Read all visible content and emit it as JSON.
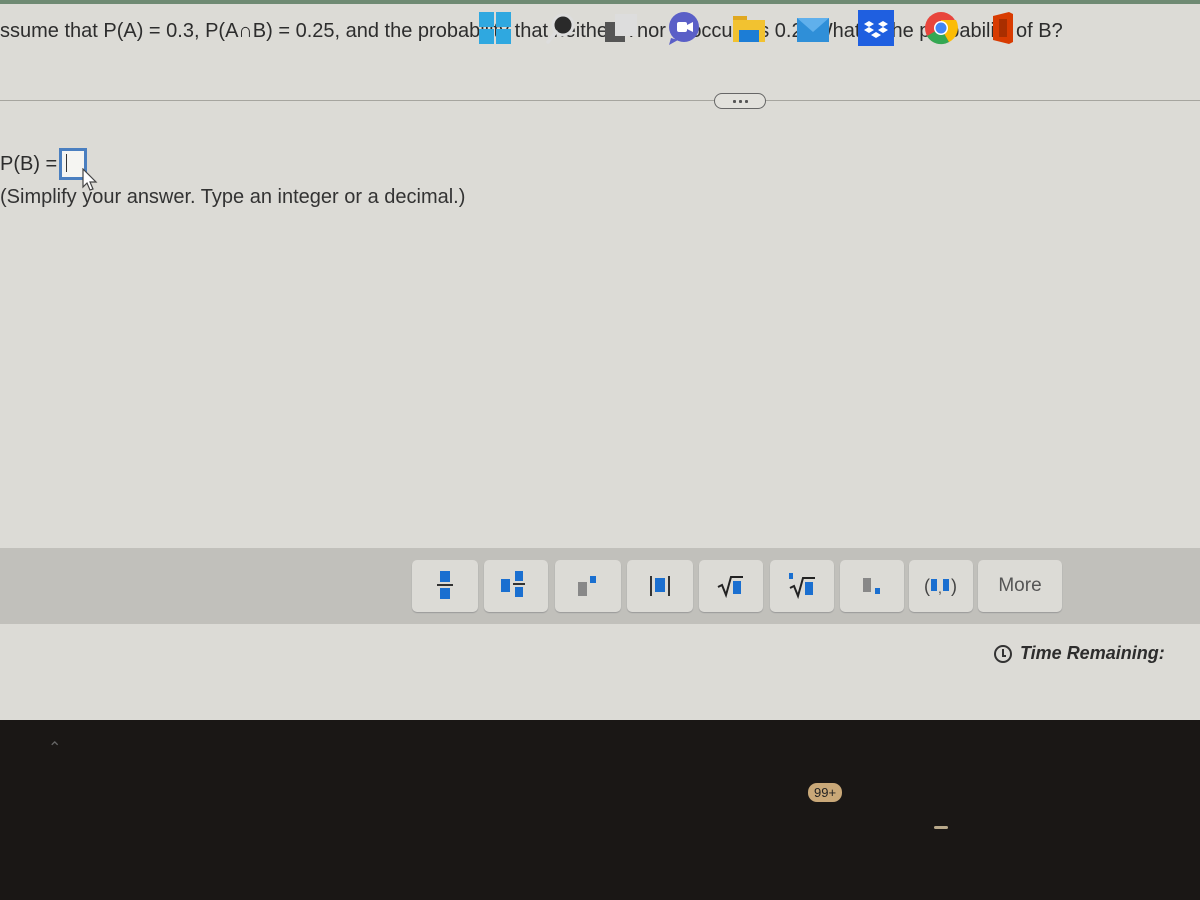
{
  "question": {
    "text": "ssume that P(A) = 0.3, P(A∩B) = 0.25, and the probability that neither A nor B occurs is 0.2. What is the probability of B?"
  },
  "expand_button": {
    "icon": "ellipsis-icon"
  },
  "answer": {
    "label": "P(B) =",
    "value": "",
    "hint": "(Simplify your answer. Type an integer or a decimal.)"
  },
  "toolbar": {
    "buttons": [
      {
        "name": "fraction",
        "icon": "fraction-icon"
      },
      {
        "name": "mixed-number",
        "icon": "mixed-number-icon"
      },
      {
        "name": "exponent",
        "icon": "exponent-icon"
      },
      {
        "name": "absolute-value",
        "icon": "absolute-value-icon"
      },
      {
        "name": "square-root",
        "icon": "square-root-icon"
      },
      {
        "name": "nth-root",
        "icon": "nth-root-icon"
      },
      {
        "name": "decimal",
        "icon": "decimal-icon"
      },
      {
        "name": "ordered-pair",
        "icon": "ordered-pair-icon"
      }
    ],
    "more_label": "More"
  },
  "timer": {
    "label": "Time Remaining:"
  },
  "taskbar": {
    "apps": [
      "start",
      "search",
      "task-view",
      "teams-chat",
      "file-explorer",
      "mail",
      "dropbox",
      "chrome",
      "office"
    ],
    "mail_badge": "99+"
  },
  "colors": {
    "accent": "#1a6fd0",
    "input_border": "#4a7fc0"
  }
}
